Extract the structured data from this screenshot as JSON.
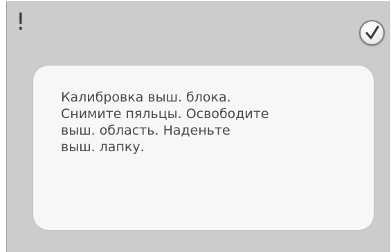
{
  "dialog": {
    "alert_symbol": "!",
    "confirm_icon": "checkmark-icon",
    "message_lines": [
      "Калибровка выш. блока.",
      "Снимите пяльцы. Освободите",
      "выш. область. Наденьте",
      "выш. лапку."
    ]
  },
  "colors": {
    "background": "#cccccc",
    "card": "#f7f7f7",
    "text": "#4a4a4a"
  }
}
